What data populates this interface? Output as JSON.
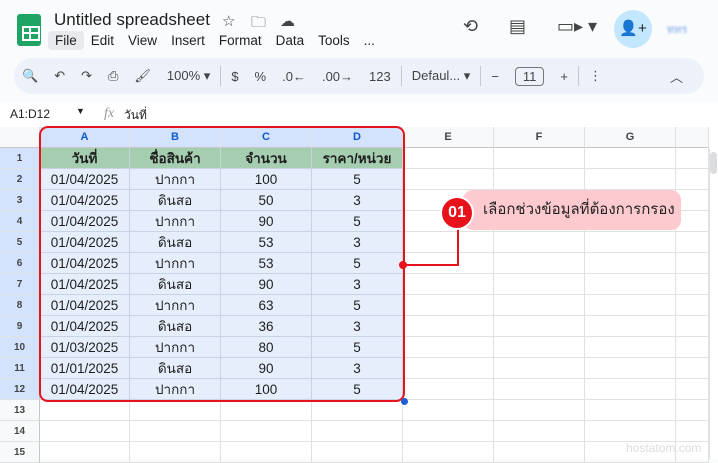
{
  "app": {
    "title": "Untitled spreadsheet",
    "menu": [
      "File",
      "Edit",
      "View",
      "Insert",
      "Format",
      "Data",
      "Tools",
      "..."
    ],
    "avatar_text": "ททร"
  },
  "toolbar": {
    "zoom": "100%",
    "currency": "$",
    "percent": "%",
    "dec_dec": ".0←",
    "inc_dec": ".00→",
    "format_123": "123",
    "font": "Defaul...",
    "font_size": "11",
    "minus": "−",
    "plus": "+"
  },
  "formula_bar": {
    "name_box": "A1:D12",
    "fx": "fx",
    "content": "วันที่"
  },
  "columns": [
    "A",
    "B",
    "C",
    "D",
    "E",
    "F",
    "G"
  ],
  "rows": [
    "1",
    "2",
    "3",
    "4",
    "5",
    "6",
    "7",
    "8",
    "9",
    "10",
    "11",
    "12",
    "13",
    "14",
    "15"
  ],
  "table": {
    "headers": [
      "วันที่",
      "ชื่อสินค้า",
      "จำนวน",
      "ราคา/หน่วย"
    ],
    "rows": [
      [
        "01/04/2025",
        "ปากกา",
        "100",
        "5"
      ],
      [
        "01/04/2025",
        "ดินสอ",
        "50",
        "3"
      ],
      [
        "01/04/2025",
        "ปากกา",
        "90",
        "5"
      ],
      [
        "01/04/2025",
        "ดินสอ",
        "53",
        "3"
      ],
      [
        "01/04/2025",
        "ปากกา",
        "53",
        "5"
      ],
      [
        "01/04/2025",
        "ดินสอ",
        "90",
        "3"
      ],
      [
        "01/04/2025",
        "ปากกา",
        "63",
        "5"
      ],
      [
        "01/04/2025",
        "ดินสอ",
        "36",
        "3"
      ],
      [
        "01/03/2025",
        "ปากกา",
        "80",
        "5"
      ],
      [
        "01/01/2025",
        "ดินสอ",
        "90",
        "3"
      ],
      [
        "01/04/2025",
        "ปากกา",
        "100",
        "5"
      ]
    ]
  },
  "callout": {
    "number": "01",
    "text": "เลือกช่วงข้อมูลที่ต้องการกรอง",
    "color": "#e8121b"
  },
  "watermark": "hostatom.com"
}
